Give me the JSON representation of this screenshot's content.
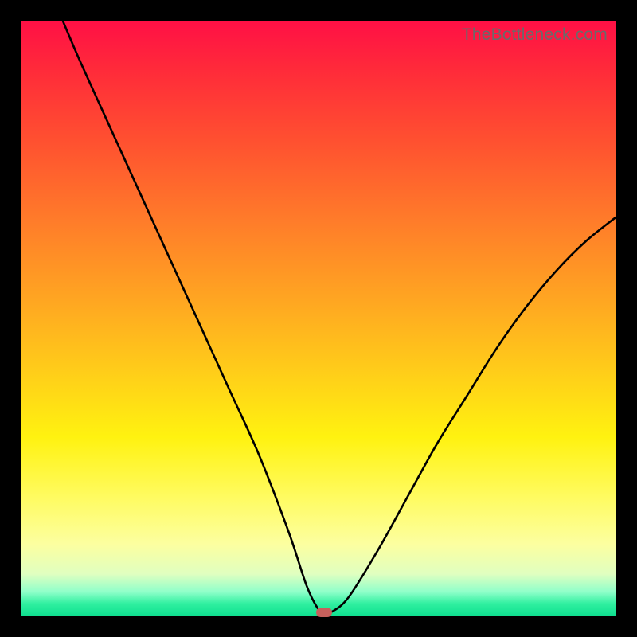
{
  "watermark": "TheBottleneck.com",
  "chart_data": {
    "type": "line",
    "title": "",
    "xlabel": "",
    "ylabel": "",
    "xlim": [
      0,
      100
    ],
    "ylim": [
      0,
      100
    ],
    "grid": false,
    "legend": false,
    "series": [
      {
        "name": "curve",
        "x": [
          7,
          10,
          15,
          20,
          25,
          30,
          35,
          40,
          45,
          48,
          50,
          51,
          52,
          55,
          60,
          65,
          70,
          75,
          80,
          85,
          90,
          95,
          100
        ],
        "y": [
          100,
          93,
          82,
          71,
          60,
          49,
          38,
          27,
          14,
          5,
          1,
          0.5,
          0.5,
          3,
          11,
          20,
          29,
          37,
          45,
          52,
          58,
          63,
          67
        ]
      }
    ],
    "marker": {
      "x": 51,
      "y": 0.5
    },
    "background_gradient": {
      "stops": [
        {
          "pos": 0,
          "color": "#ff1045"
        },
        {
          "pos": 20,
          "color": "#ff5030"
        },
        {
          "pos": 46,
          "color": "#ffa322"
        },
        {
          "pos": 70,
          "color": "#fff210"
        },
        {
          "pos": 93,
          "color": "#e0ffc0"
        },
        {
          "pos": 100,
          "color": "#10e090"
        }
      ]
    }
  }
}
